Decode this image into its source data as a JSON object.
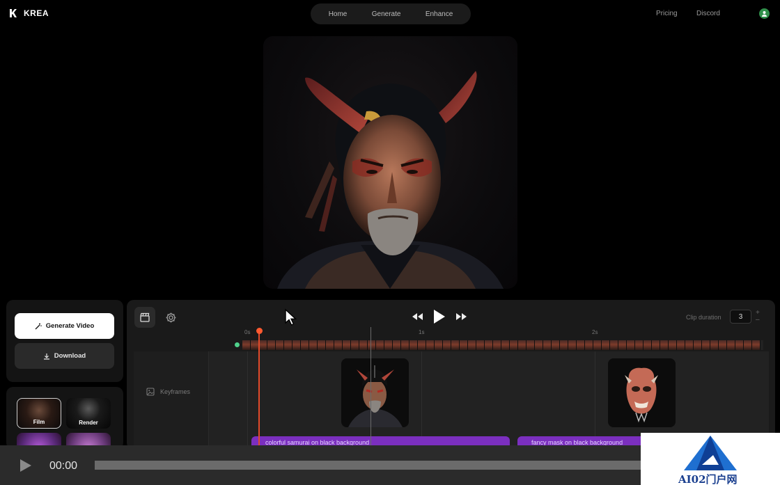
{
  "app": {
    "name": "KREA"
  },
  "nav": {
    "items": [
      "Home",
      "Generate",
      "Enhance"
    ]
  },
  "nav_right": {
    "pricing": "Pricing",
    "discord": "Discord"
  },
  "left_panel": {
    "generate_label": "Generate Video",
    "download_label": "Download",
    "styles": [
      {
        "label": "Film"
      },
      {
        "label": "Render"
      }
    ]
  },
  "timeline": {
    "clip_duration_label": "Clip duration",
    "clip_duration_value": "3",
    "ruler": [
      "0s",
      "1s",
      "2s"
    ],
    "keyframes_label": "Keyframes",
    "prompts": [
      "colorful samurai on black background",
      "fancy mask on black background"
    ]
  },
  "player": {
    "time": "00:00"
  },
  "watermark": {
    "text": "AI02门户网"
  },
  "colors": {
    "accent_purple": "#7b2fbf",
    "playhead": "#e24a2a",
    "status_green": "#4fd18b"
  }
}
